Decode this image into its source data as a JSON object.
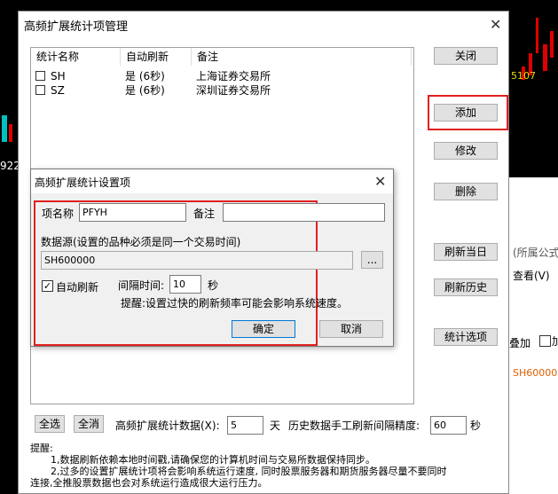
{
  "main_dialog": {
    "title": "高频扩展统计项管理",
    "list": {
      "headers": [
        "统计名称",
        "自动刷新",
        "备注"
      ],
      "rows": [
        {
          "name": "SH",
          "auto": "是 (6秒)",
          "note": "上海证券交易所"
        },
        {
          "name": "SZ",
          "auto": "是 (6秒)",
          "note": "深圳证券交易所"
        }
      ]
    },
    "buttons": {
      "close": "关闭",
      "add": "添加",
      "modify": "修改",
      "delete": "删除",
      "refresh_today": "刷新当日",
      "refresh_history": "刷新历史",
      "options": "统计选项"
    },
    "bottom": {
      "select_all": "全选",
      "select_none": "全消",
      "days_label": "高频扩展统计数据(X):",
      "days_value": "5",
      "days_unit": "天",
      "interval_label": "历史数据手工刷新间隔精度:",
      "interval_value": "60",
      "interval_unit": "秒"
    },
    "notice": {
      "title": "提醒:",
      "line1": "1,数据刷新依赖本地时间戳,请确保您的计算机时间与交易所数据保持同步。",
      "line2": "2,过多的设置扩展统计项将会影响系统运行速度, 同时股票服务器和期货服务器尽量不要同时",
      "line3": "连接,全推股票数据也会对系统运行造成很大运行压力。"
    }
  },
  "sub_dialog": {
    "title": "高频扩展统计设置项",
    "item_name_label": "项名称",
    "item_name_value": "PFYH",
    "note_label": "备注",
    "note_value": "",
    "source_label": "数据源(设置的品种必须是同一个交易时间)",
    "source_value": "SH600000",
    "browse_label": "...",
    "auto_refresh_label": "自动刷新",
    "auto_refresh_checked": true,
    "interval_label": "间隔时间:",
    "interval_value": "10",
    "interval_unit": "秒",
    "warning": "提醒:设置过快的刷新频率可能会影响系统速度。",
    "ok": "确定",
    "cancel": "取消"
  },
  "background": {
    "left_number": "922",
    "chart_label": "5107",
    "panel_text1": "(所属公式",
    "panel_text2": "查看(V)",
    "panel_text3": "叠加",
    "panel_text4": "加",
    "panel_text5": "SH60000"
  },
  "colors": {
    "highlight": "#e02020",
    "candle_up": "#e00000",
    "candle_down": "#00c0c0",
    "ok_button_border": "#0078d7"
  }
}
